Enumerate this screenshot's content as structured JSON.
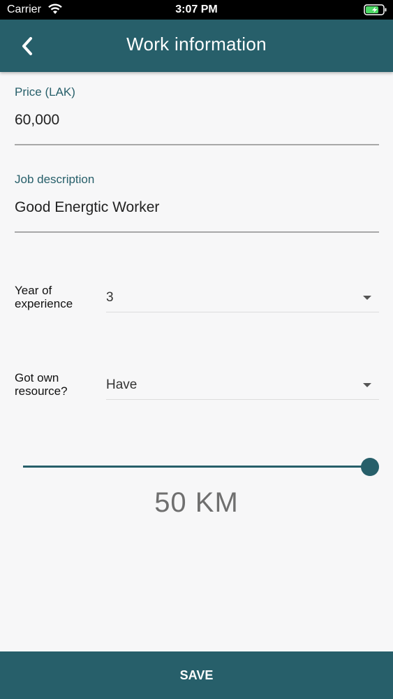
{
  "status_bar": {
    "carrier": "Carrier",
    "time": "3:07 PM"
  },
  "header": {
    "title": "Work information"
  },
  "form": {
    "price": {
      "label": "Price (LAK)",
      "value": "60,000"
    },
    "job_description": {
      "label": "Job description",
      "value": "Good Energtic Worker"
    },
    "experience": {
      "label_line1": "Year of",
      "label_line2": "experience",
      "value": "3"
    },
    "resource": {
      "label_line1": "Got own",
      "label_line2": "resource?",
      "value": "Have"
    },
    "distance": {
      "value": 50,
      "max": 50,
      "display": "50 KM"
    }
  },
  "footer": {
    "save_label": "SAVE"
  },
  "colors": {
    "accent": "#275f6a",
    "status_bar_bg": "#000000",
    "battery_green": "#4cd964"
  }
}
